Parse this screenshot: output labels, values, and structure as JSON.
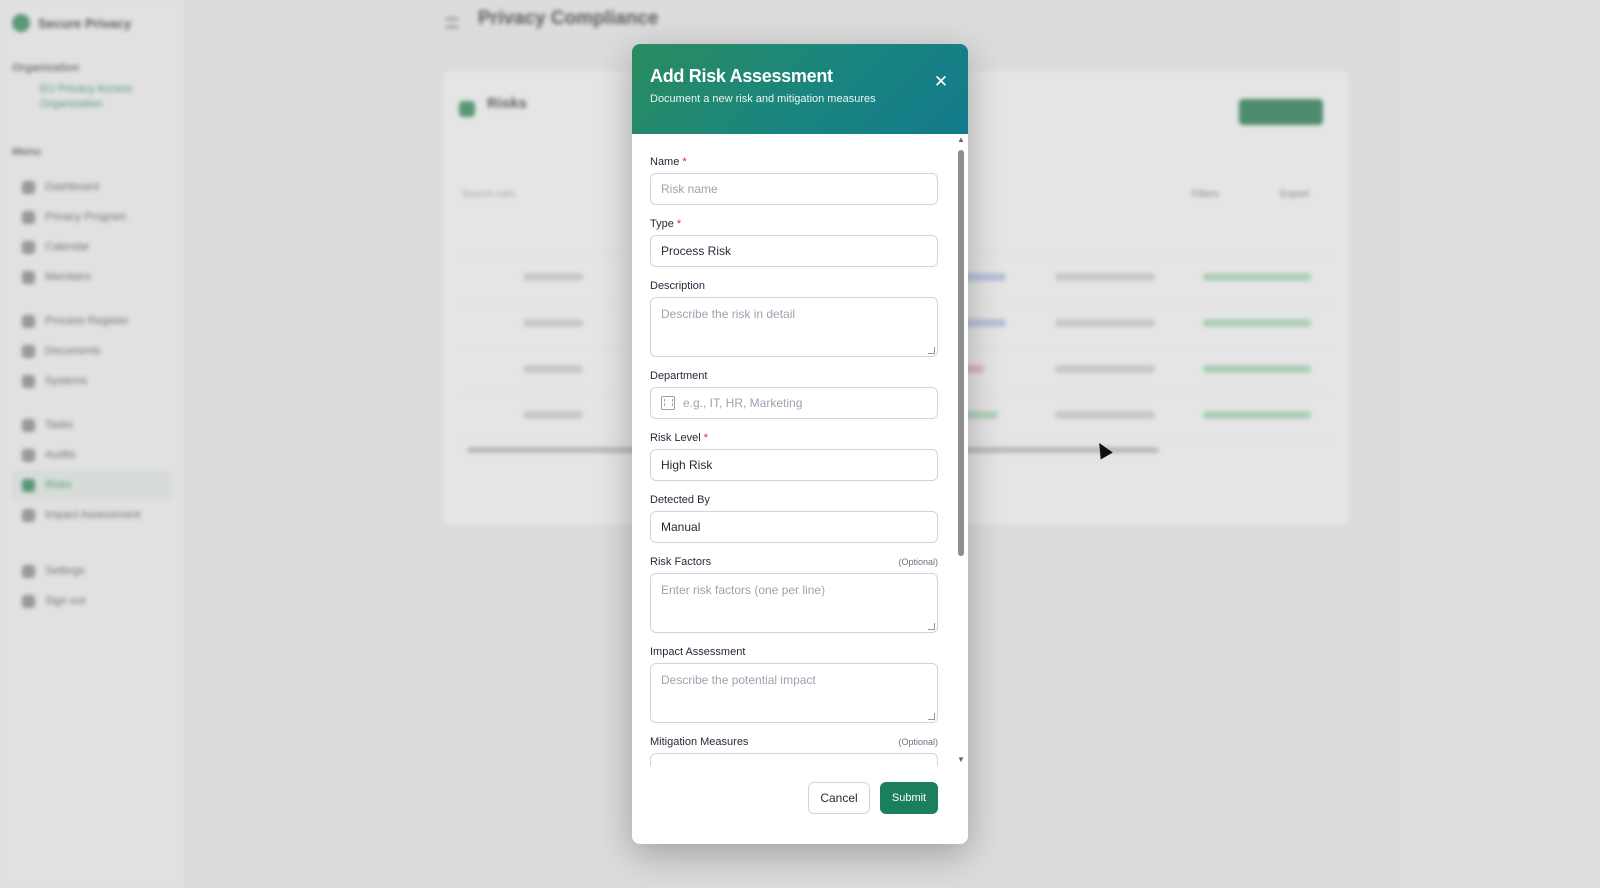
{
  "background": {
    "brand": "Secure Privacy",
    "org_section": "Organization",
    "org_name": "EU Privacy Access Organization",
    "menu_section": "Menu",
    "sidebar_items": [
      "Dashboard",
      "Privacy Program",
      "Calendar",
      "Members",
      "Process Register",
      "Documents",
      "Systems",
      "Tasks",
      "Audits",
      "Risks",
      "Impact Assessment",
      "Settings",
      "Sign out"
    ],
    "page_title": "Privacy Compliance",
    "card_title": "Risks",
    "search_placeholder": "Search risks",
    "filters_label": "Filters",
    "export_label": "Export"
  },
  "modal": {
    "title": "Add Risk Assessment",
    "subtitle": "Document a new risk and mitigation measures",
    "close_glyph": "✕",
    "optional_text": "(Optional)",
    "fields": {
      "name": {
        "label": "Name",
        "required_mark": "*",
        "placeholder": "Risk name"
      },
      "type": {
        "label": "Type",
        "required_mark": "*",
        "value": "Process Risk"
      },
      "description": {
        "label": "Description",
        "placeholder": "Describe the risk in detail"
      },
      "department": {
        "label": "Department",
        "placeholder": "e.g., IT, HR, Marketing"
      },
      "risk_level": {
        "label": "Risk Level",
        "required_mark": "*",
        "value": "High Risk"
      },
      "detected_by": {
        "label": "Detected By",
        "value": "Manual"
      },
      "risk_factors": {
        "label": "Risk Factors",
        "placeholder": "Enter risk factors (one per line)"
      },
      "impact_assessment": {
        "label": "Impact Assessment",
        "placeholder": "Describe the potential impact"
      },
      "mitigation_measures": {
        "label": "Mitigation Measures"
      }
    },
    "scroll_up": "▲",
    "scroll_down": "▼",
    "cancel_label": "Cancel",
    "submit_label": "Submit"
  }
}
